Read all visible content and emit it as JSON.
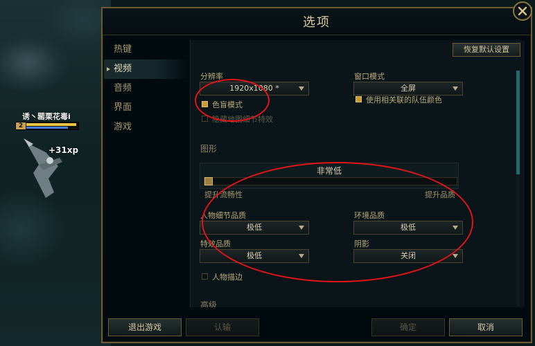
{
  "world": {
    "champion_name": "诱丶罂栗花毒i",
    "champion_level": "2",
    "xp_popup": "+31xp"
  },
  "dialog": {
    "title": "选项",
    "sidebar": {
      "items": [
        {
          "label": "热键",
          "active": false
        },
        {
          "label": "视频",
          "active": true
        },
        {
          "label": "音频",
          "active": false
        },
        {
          "label": "界面",
          "active": false
        },
        {
          "label": "游戏",
          "active": false
        }
      ]
    },
    "restore_defaults_label": "恢复默认设置",
    "video": {
      "resolution_label": "分辨率",
      "resolution_value": "1920x1080 *",
      "window_mode_label": "窗口模式",
      "window_mode_value": "全屏",
      "colorblind_label": "色盲模式",
      "colorblind_checked": true,
      "team_colors_label": "使用相关联的队伍颜色",
      "team_colors_checked": true,
      "hide_eyecandy_label": "隐藏地图细节特效",
      "hide_eyecandy_checked": false
    },
    "graphics": {
      "section_title": "图形",
      "quality_value": "非常低",
      "quality_level": 0,
      "slider_min_label": "提升流畅性",
      "slider_max_label": "提升品质",
      "character_quality_label": "人物细节品质",
      "character_quality_value": "极低",
      "environment_quality_label": "环境品质",
      "environment_quality_value": "极低",
      "effects_quality_label": "特效品质",
      "effects_quality_value": "极低",
      "shadows_label": "阴影",
      "shadows_value": "关闭",
      "character_inking_label": "人物描边",
      "character_inking_checked": false,
      "next_section_title": "高级"
    },
    "buttons": {
      "exit_game": "退出游戏",
      "surrender": "认输",
      "ok": "确定",
      "cancel": "取消"
    }
  },
  "colors": {
    "gold_border": "#6e5b32",
    "annotation_red": "#e3141a",
    "checkbox_on": "#c99a35"
  }
}
